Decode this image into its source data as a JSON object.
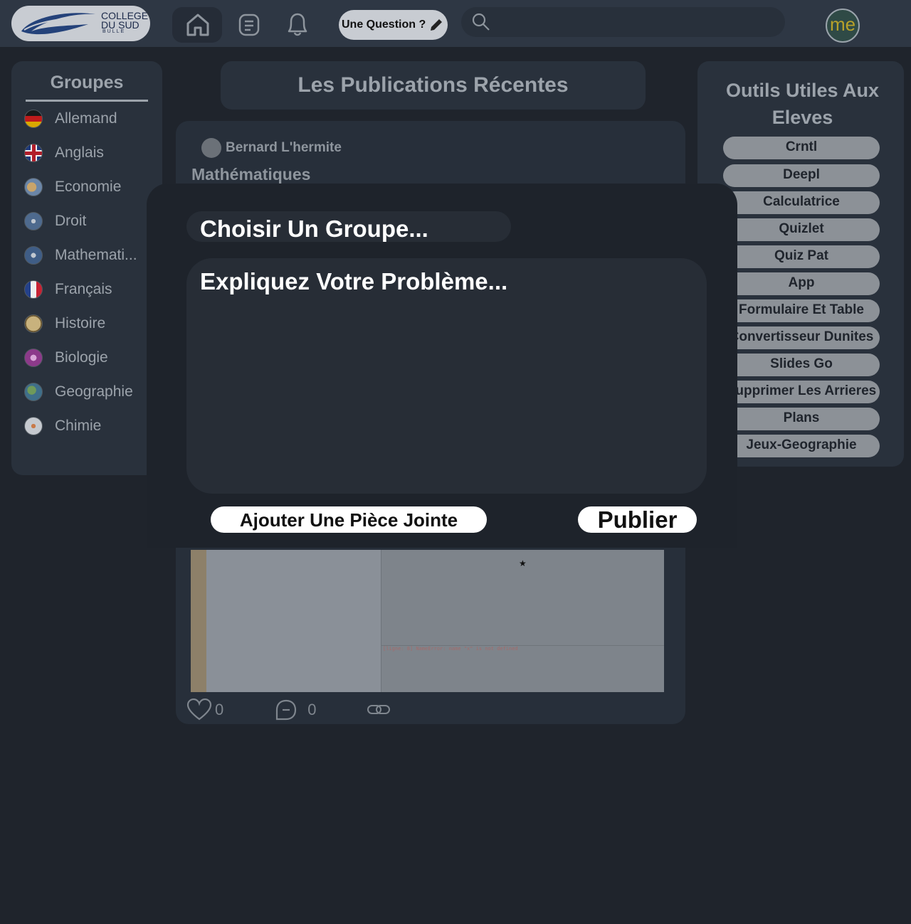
{
  "logo": {
    "line1": "COLLEGE",
    "line2": "DU SUD",
    "line3": "BULLE"
  },
  "nav": {
    "home_icon": "home-icon",
    "list_icon": "document-list-icon",
    "bell_icon": "bell-icon",
    "ask_label": "Une Question ?",
    "ask_icon": "pencil-icon",
    "search_icon": "search-icon",
    "search_placeholder": "",
    "avatar_text": "me"
  },
  "groups": {
    "title": "Groupes",
    "items": [
      {
        "label": "Allemand",
        "icon": "flag-germany-icon"
      },
      {
        "label": "Anglais",
        "icon": "flag-uk-icon"
      },
      {
        "label": "Economie",
        "icon": "handshake-icon"
      },
      {
        "label": "Droit",
        "icon": "scales-icon"
      },
      {
        "label": "Mathemati...",
        "icon": "math-symbols-icon"
      },
      {
        "label": "Français",
        "icon": "flag-france-icon"
      },
      {
        "label": "Histoire",
        "icon": "clock-icon"
      },
      {
        "label": "Biologie",
        "icon": "dna-icon"
      },
      {
        "label": "Geographie",
        "icon": "globe-icon"
      },
      {
        "label": "Chimie",
        "icon": "flask-icon"
      }
    ]
  },
  "feed": {
    "header": "Les Publications Récentes",
    "post": {
      "author": "Bernard L'hermite",
      "group": "Mathématiques",
      "preview_error": "[ligne: 8] NameError: name \"x\" is not defined",
      "preview_marker": "★",
      "likes": "0",
      "comments": "0",
      "like_icon": "heart-icon",
      "comment_icon": "comment-icon",
      "link_icon": "link-icon"
    }
  },
  "tools": {
    "title": "Outils Utiles Aux Eleves",
    "items": [
      "Crntl",
      "Deepl",
      "Calculatrice",
      "Quizlet",
      "Quiz Pat",
      "App",
      "Formulaire Et Table",
      "Convertisseur Dunites",
      "Slides Go",
      "Supprimer Les Arrieres",
      "Plans",
      "Jeux-Geographie"
    ]
  },
  "modal": {
    "group_placeholder": "Choisir Un Groupe...",
    "problem_placeholder": "Expliquez Votre Problème...",
    "attach_label": "Ajouter Une Pièce Jointe",
    "publish_label": "Publier"
  },
  "colors": {
    "background": "#1f242c",
    "panel": "#29313c",
    "modal": "#1e232b",
    "button_light": "#ffffff"
  }
}
